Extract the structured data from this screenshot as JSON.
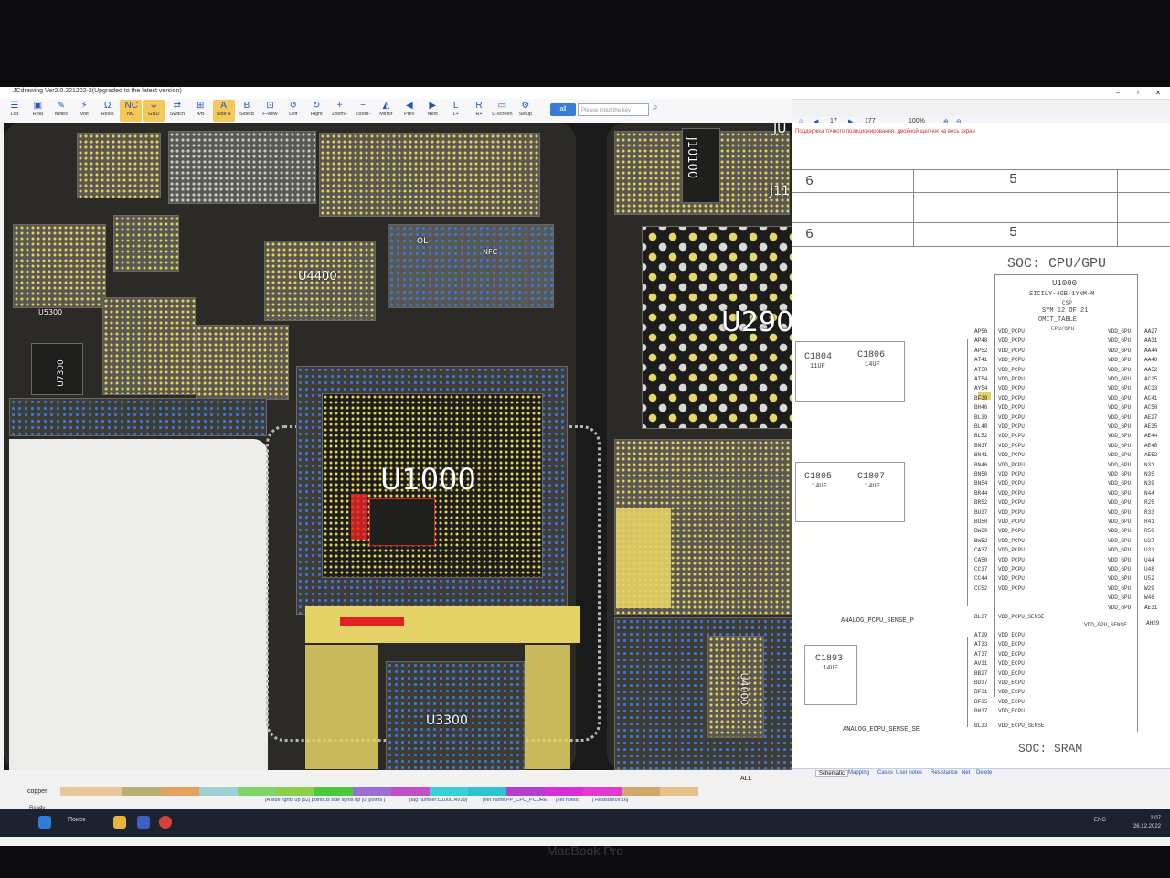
{
  "window": {
    "title": "JCdrawing Ver2.0.221202-2(Upgraded to the latest version)"
  },
  "toolbar": {
    "items": [
      {
        "label": "List",
        "icon": "list-icon"
      },
      {
        "label": "Real",
        "icon": "real-icon"
      },
      {
        "label": "Notes",
        "icon": "notes-icon"
      },
      {
        "label": "Volt",
        "icon": "volt-icon"
      },
      {
        "label": "Resis",
        "icon": "resistance-icon"
      },
      {
        "label": "NC",
        "icon": "nc-icon",
        "active": true
      },
      {
        "label": "GND",
        "icon": "gnd-icon",
        "active": true
      },
      {
        "label": "Switch",
        "icon": "switch-icon"
      },
      {
        "label": "A/B",
        "icon": "ab-icon"
      },
      {
        "label": "Side A",
        "icon": "side-a-icon",
        "active": true
      },
      {
        "label": "Side B",
        "icon": "side-b-icon"
      },
      {
        "label": "F-view",
        "icon": "f-view-icon"
      },
      {
        "label": "Left",
        "icon": "rotate-left-icon"
      },
      {
        "label": "Right",
        "icon": "rotate-right-icon"
      },
      {
        "label": "Zoom+",
        "icon": "zoom-in-icon"
      },
      {
        "label": "Zoom-",
        "icon": "zoom-out-icon"
      },
      {
        "label": "Mirror",
        "icon": "mirror-icon"
      },
      {
        "label": "Prev",
        "icon": "prev-icon"
      },
      {
        "label": "Next",
        "icon": "next-icon"
      },
      {
        "label": "L+",
        "icon": "layer-plus-icon"
      },
      {
        "label": "R+",
        "icon": "r-plus-icon"
      },
      {
        "label": "D-screen",
        "icon": "d-screen-icon"
      },
      {
        "label": "Setup",
        "icon": "setup-icon"
      }
    ],
    "key_select": "all",
    "key_placeholder": "Please input the key"
  },
  "board": {
    "labels": {
      "u1000": "U1000",
      "u2900": "U290",
      "u4400": "U4400",
      "u3300": "U3300",
      "u4000": "U4000",
      "u7300": "U7300",
      "j10100": "J10100",
      "j11": "J11",
      "ju": "JU",
      "u5300": "U5300",
      "ol": "OL",
      "nfc": "NFC"
    }
  },
  "schematic": {
    "toolbar": {
      "page": "17",
      "total": "177",
      "zoom": "100%"
    },
    "notice": "Поддержка точного позиционирования, двойной щелчок на весь экран",
    "grid_cols": [
      "6",
      "5"
    ],
    "title": "SOC: CPU/GPU",
    "part_ref": "U1000",
    "part_name": "SICILY-4GB-1YNM-M",
    "part_pkg": "CSP",
    "sym": "SYM 12 OF 21",
    "omit": "OMIT_TABLE",
    "unit": "CPU/GPU",
    "caps": [
      {
        "ref": "C1804",
        "val": "11UF"
      },
      {
        "ref": "C1806",
        "val": "14UF"
      },
      {
        "ref": "C1805",
        "val": "14UF"
      },
      {
        "ref": "C1807",
        "val": "14UF"
      },
      {
        "ref": "C1893",
        "val": "14UF"
      }
    ],
    "left_pins": [
      "AP56",
      "AP48",
      "AP52",
      "AT41",
      "AT50",
      "AT54",
      "AY54",
      "BF39",
      "BH46",
      "BL39",
      "BL48",
      "BL52",
      "BN37",
      "BN41",
      "BN46",
      "BN50",
      "BN54",
      "BR44",
      "BR52",
      "BU37",
      "BU50",
      "BW39",
      "BW52",
      "CA37",
      "CA50",
      "CC37",
      "CC44",
      "CC52"
    ],
    "left_nets_label": "VDD_PCPU",
    "right_pins": [
      "AA27",
      "AA31",
      "AA44",
      "AA48",
      "AA52",
      "AC25",
      "AC33",
      "AC41",
      "AC50",
      "AE27",
      "AE35",
      "AE44",
      "AE48",
      "AE52",
      "N31",
      "N35",
      "N39",
      "N44",
      "R25",
      "R33",
      "R41",
      "R50",
      "U27",
      "U31",
      "U44",
      "U48",
      "U52",
      "W29",
      "W46",
      "AE31"
    ],
    "right_nets_label": "VDD_GPU",
    "sense_pin": "BL37",
    "sense_net": "VDD_PCPU_SENSE",
    "sense_label": "ANALOG_PCPU_SENSE_P",
    "gpu_sense_net": "VDD_GPU_SENSE",
    "gpu_sense_pin": "AH29",
    "ecpu_pins": [
      "AT29",
      "AT33",
      "AT37",
      "AV31",
      "BB27",
      "BD37",
      "BF31",
      "BF35",
      "BH37"
    ],
    "ecpu_net": "VDD_ECPU",
    "ecpu_sense_pin": "BL33",
    "ecpu_sense_net": "VDD_ECPU_SENSE",
    "ecpu_sense_label": "ANALOG_ECPU_SENSE_SE",
    "next_title": "SOC: SRAM"
  },
  "schematic_tabs": [
    "Schematic",
    "Mapping",
    "Cases",
    "User notes",
    "Resistance",
    "Net",
    "Delete"
  ],
  "layer": {
    "name": "copper",
    "all_label": "ALL"
  },
  "status": {
    "ready": "Ready",
    "points": "[A side lights up [52] points,B side lights up [0] points ]",
    "tag": "[tag number:U1000.AV29]",
    "net": "[net name:PP_CPU_PCORE]",
    "notes": "[net notes:]",
    "resistance": "[ Resistance:16]"
  },
  "taskbar": {
    "search": "Поиск",
    "lang": "ENG",
    "time": "2:07",
    "date": "26.12.2022"
  },
  "device": "MacBook Pro",
  "colors": {
    "pad_yellow": "#e4d266",
    "board_dark": "#2b2a26",
    "accent_blue": "#2457b8",
    "highlight_red": "#e12222"
  }
}
